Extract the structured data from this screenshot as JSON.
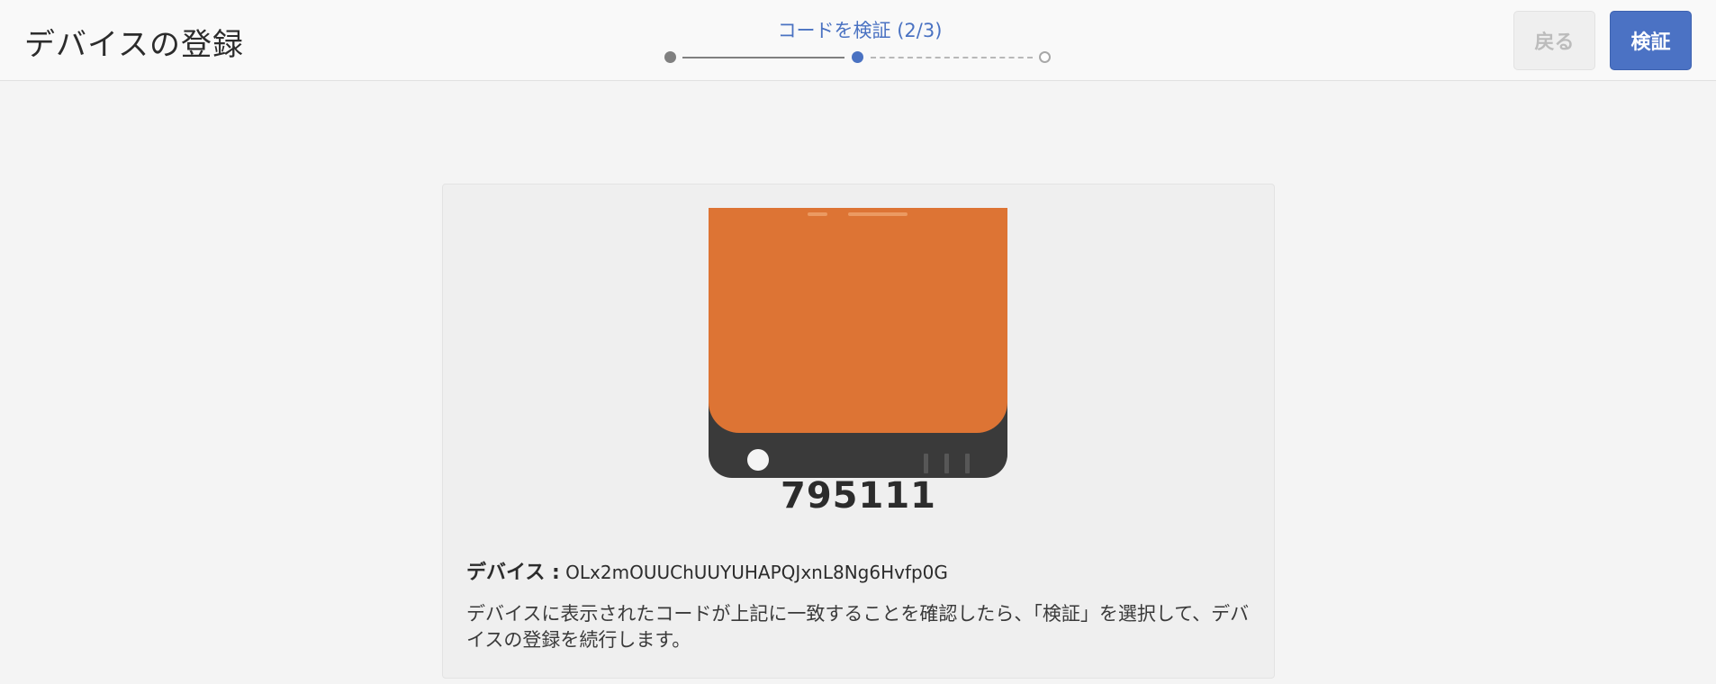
{
  "header": {
    "title": "デバイスの登録",
    "step_label": "コードを検証 (2/3)",
    "steps": {
      "total": 3,
      "current": 2
    },
    "back_label": "戻る",
    "verify_label": "検証"
  },
  "main": {
    "device_icon": "device-icon",
    "code": "795111",
    "device_label": "デバイス :",
    "device_id": "OLx2mOUUChUUYUHAPQJxnL8Ng6Hvfp0G",
    "instructions": "デバイスに表示されたコードが上記に一致することを確認したら、「検証」を選択して、デバイスの登録を続行します。"
  },
  "colors": {
    "accent": "#4b72c4",
    "device_screen": "#dd7434",
    "device_body": "#3a3a3a"
  }
}
